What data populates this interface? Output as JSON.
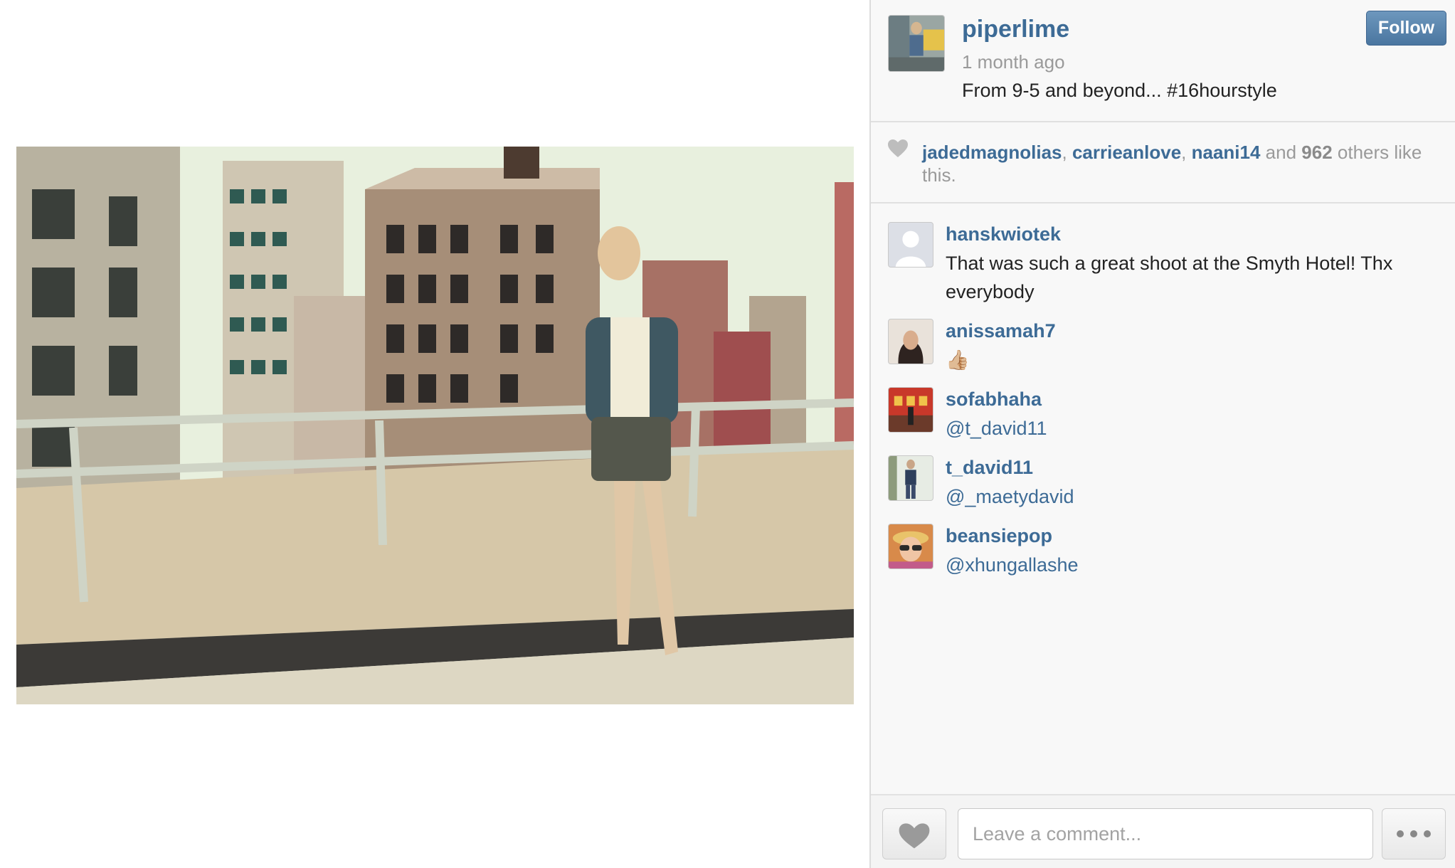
{
  "post": {
    "username": "piperlime",
    "time_ago": "1 month ago",
    "caption": "From 9-5 and beyond... #16hourstyle",
    "follow_label": "Follow"
  },
  "likes": {
    "users": [
      "jadedmagnolias",
      "carrieanlove",
      "naani14"
    ],
    "sep1": ", ",
    "sep2": ", ",
    "and_text": " and ",
    "others_count": "962",
    "others_text": " others like this."
  },
  "comments": [
    {
      "username": "hanskwiotek",
      "text": "That was such a great shoot at the Smyth Hotel! Thx everybody"
    },
    {
      "username": "anissamah7",
      "text": "👍🏼"
    },
    {
      "username": "sofabhaha",
      "text": "@t_david11"
    },
    {
      "username": "t_david11",
      "text": "@_maetydavid"
    },
    {
      "username": "beansiepop",
      "text": "@xhungallashe"
    }
  ],
  "footer": {
    "comment_placeholder": "Leave a comment..."
  },
  "icons": {
    "likes": "heart-icon",
    "like_button": "heart-icon",
    "more_button": "ellipsis-icon"
  },
  "colors": {
    "link": "#3d6b96",
    "follow_button": "#4a76a0",
    "muted_text": "#9a9a9a"
  }
}
